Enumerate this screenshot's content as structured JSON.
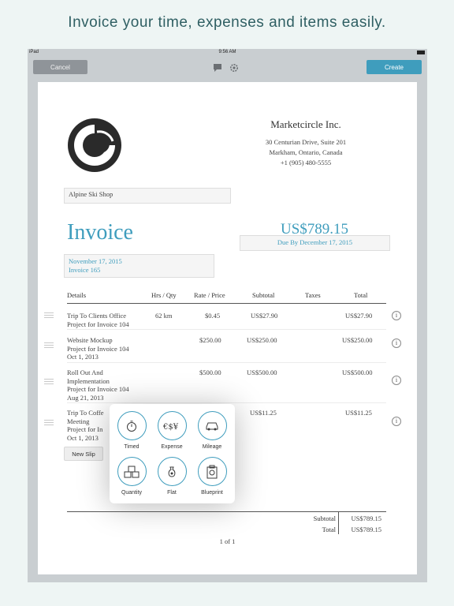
{
  "headline": "Invoice your time, expenses and items easily.",
  "status_bar": {
    "device": "iPad",
    "time": "9:56 AM"
  },
  "toolbar": {
    "cancel_label": "Cancel",
    "create_label": "Create",
    "icons": [
      "chat-bubble-icon",
      "gear-icon"
    ]
  },
  "company": {
    "name": "Marketcircle Inc.",
    "address_line1": "30 Centurian Drive, Suite 201",
    "address_line2": "Markham, Ontario, Canada",
    "phone": "+1 (905) 480-5555"
  },
  "client": {
    "name": "Alpine Ski Shop"
  },
  "invoice": {
    "title": "Invoice",
    "amount": "US$789.15",
    "due": "Due By December 17, 2015",
    "date": "November 17, 2015",
    "number": "Invoice 165"
  },
  "table": {
    "headers": {
      "details": "Details",
      "hrs_qty": "Hrs / Qty",
      "rate_price": "Rate / Price",
      "subtotal": "Subtotal",
      "taxes": "Taxes",
      "total": "Total"
    },
    "rows": [
      {
        "line1": "Trip To Clients Office",
        "line2": "Project for Invoice 104",
        "hrs_qty": "62 km",
        "rate": "$0.45",
        "subtotal": "US$27.90",
        "total": "US$27.90"
      },
      {
        "line1": "Website Mockup",
        "line2": "Project for Invoice 104",
        "line3": "Oct 1, 2013",
        "rate": "$250.00",
        "subtotal": "US$250.00",
        "total": "US$250.00"
      },
      {
        "line1": "Roll Out And",
        "line2": "Implementation",
        "line3": "Project for Invoice 104",
        "line4": "Aug 21, 2013",
        "rate": "$500.00",
        "subtotal": "US$500.00",
        "total": "US$500.00"
      },
      {
        "line1": "Trip To Coffe",
        "line2": "Meeting",
        "line3": "Project for In",
        "line4": "Oct 1, 2013",
        "subtotal": "US$11.25",
        "total": "US$11.25"
      }
    ]
  },
  "info_glyph": "i",
  "new_slip_label": "New Slip",
  "slip_types": {
    "timed": "Timed",
    "expense": "Expense",
    "mileage": "Mileage",
    "quantity": "Quantity",
    "flat": "Flat",
    "blueprint": "Blueprint"
  },
  "totals": {
    "subtotal_label": "Subtotal",
    "subtotal_value": "US$789.15",
    "total_label": "Total",
    "total_value": "US$789.15"
  },
  "page_indicator": "1 of 1",
  "colors": {
    "accent": "#3f9dbd",
    "cancel": "#8f9499",
    "headline": "#2f5f63"
  }
}
